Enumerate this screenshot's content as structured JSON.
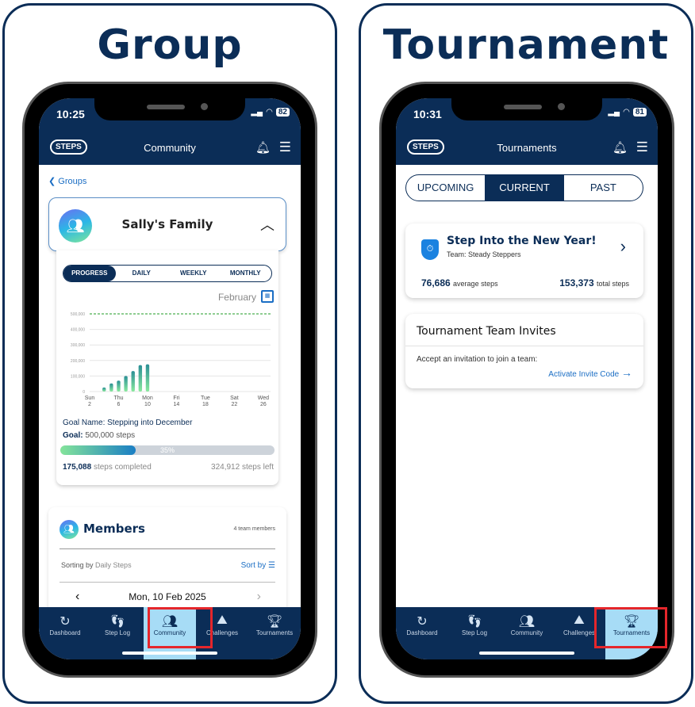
{
  "panels": {
    "group": {
      "heading": "Group",
      "status": {
        "time": "10:25",
        "battery": "82"
      },
      "appbar": {
        "logo": "10,000 STEPS",
        "title": "Community"
      },
      "back_label": "Groups",
      "group_name": "Sally's Family",
      "segments": [
        "PROGRESS",
        "DAILY",
        "WEEKLY",
        "MONTHLY"
      ],
      "active_segment": "PROGRESS",
      "month": "February",
      "goal_name_label": "Goal Name: Stepping into December",
      "goal_label": "Goal:",
      "goal_value": "500,000 steps",
      "progress_percent": 35,
      "progress_label": "35%",
      "steps_completed": "175,088",
      "steps_completed_label": "steps completed",
      "steps_left": "324,912",
      "steps_left_label": "steps left",
      "members": {
        "title": "Members",
        "count": "4 team members",
        "sorting_prefix": "Sorting by",
        "sorting_value": "Daily Steps",
        "sort_by": "Sort by",
        "date": "Mon, 10 Feb 2025"
      },
      "active_tab": "Community"
    },
    "tournament": {
      "heading": "Tournament",
      "status": {
        "time": "10:31",
        "battery": "81"
      },
      "appbar": {
        "logo": "10,000 STEPS",
        "title": "Tournaments"
      },
      "segments": [
        "UPCOMING",
        "CURRENT",
        "PAST"
      ],
      "active_segment": "CURRENT",
      "card": {
        "title": "Step Into the New Year!",
        "team": "Team: Steady Steppers",
        "average_value": "76,686",
        "average_label": "average steps",
        "total_value": "153,373",
        "total_label": "total steps"
      },
      "invites": {
        "title": "Tournament Team Invites",
        "text": "Accept an invitation to join a team:",
        "link": "Activate Invite Code"
      },
      "active_tab": "Tournaments"
    }
  },
  "tabs": [
    {
      "label": "Dashboard",
      "icon": "refresh-icon"
    },
    {
      "label": "Step Log",
      "icon": "footprints-icon"
    },
    {
      "label": "Community",
      "icon": "people-icon"
    },
    {
      "label": "Challenges",
      "icon": "mountain-flag-icon"
    },
    {
      "label": "Tournaments",
      "icon": "trophy-icon"
    }
  ],
  "colors": {
    "navy": "#0b2d57",
    "active_tab": "#a7dcf6",
    "highlight": "#e5262b",
    "link": "#1b6ec4",
    "goal_line": "#4caf50"
  },
  "chart_data": {
    "type": "bar",
    "title": "February",
    "x_ticks": [
      "Sun 2",
      "Thu 6",
      "Mon 10",
      "Fri 14",
      "Tue 18",
      "Sat 22",
      "Wed 26"
    ],
    "x": [
      4,
      5,
      6,
      7,
      8,
      9,
      10
    ],
    "x_range": [
      2,
      27
    ],
    "values": [
      26000,
      52000,
      70000,
      100000,
      132000,
      170000,
      175088
    ],
    "y_ticks": [
      "0",
      "100,000",
      "200,000",
      "300,000",
      "400,000",
      "500,000"
    ],
    "ylim": [
      0,
      500000
    ],
    "goal_line": 500000,
    "grid": true
  }
}
